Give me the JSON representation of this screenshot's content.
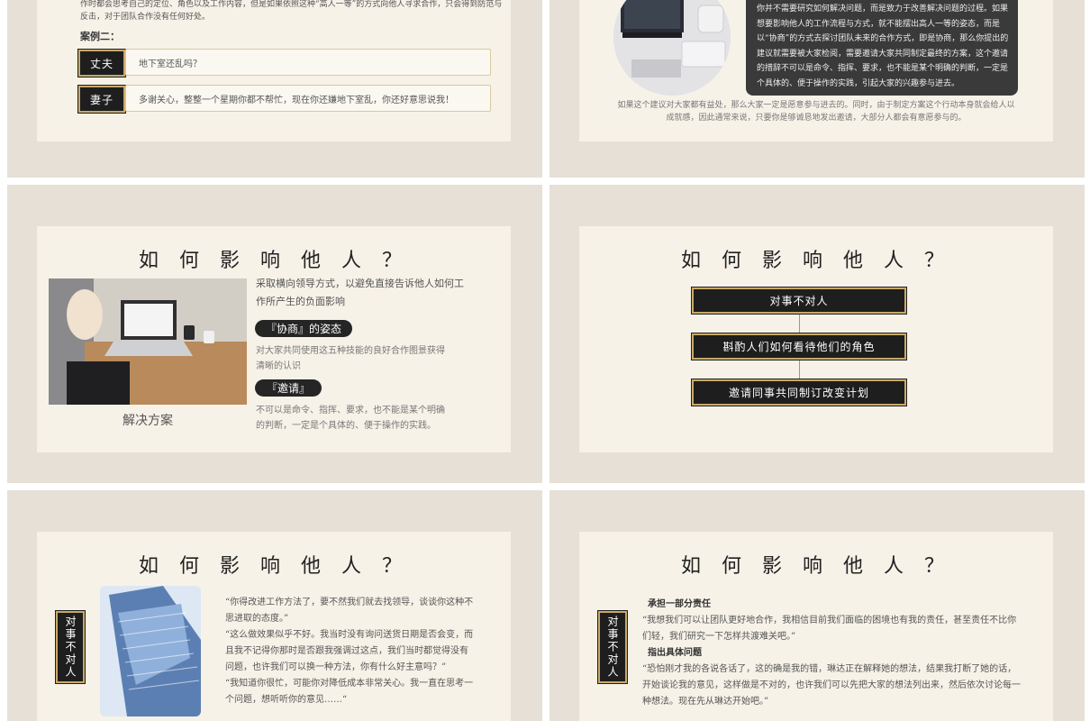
{
  "slide1": {
    "intro": "作时都会思考自己的定位、角色以及工作内容，但是如果依照这种“高人一等”的方式向他人寻求合作，只会得到防范与反击，对于团队合作没有任何好处。",
    "case_label": "案例二：",
    "rows": [
      {
        "role": "丈夫",
        "text": "地下室还乱吗？"
      },
      {
        "role": "妻子",
        "text": "多谢关心，整整一个星期你都不帮忙，现在你还嫌地下室乱，你还好意思说我！"
      }
    ]
  },
  "slide2": {
    "dark_text": "你并不需要研究如何解决问题，而是致力于改善解决问题的过程。如果想要影响他人的工作流程与方式，就不能摆出高人一等的姿态，而是以“协商”的方式去探讨团队未来的合作方式，即是协商，那么你提出的建议就需要被大家检阅，需要邀请大家共同制定最终的方案，这个邀请的措辞不可以是命令、指挥、要求，也不能是某个明确的判断，一定是个具体的、便于操作的实践，引起大家的兴趣参与进去。",
    "bottom_text": "如果这个建议对大家都有益处，那么大家一定是愿意参与进去的。同时，由于制定方案这个行动本身就会给人以成就感，因此通常来说，只要你是够诚恳地发出邀请，大部分人都会有意愿参与的。"
  },
  "slide3": {
    "title": "如 何 影 响 他 人 ？",
    "intro": "采取横向领导方式，以避免直接告诉他人如何工作所产生的负面影响",
    "pill1": "『协商』的姿态",
    "text1": "对大家共同使用这五种技能的良好合作图景获得清晰的认识",
    "pill2": "『邀请』",
    "text2": "不可以是命令、指挥、要求，也不能是某个明确的判断，一定是个具体的、便于操作的实践。",
    "caption": "解决方案"
  },
  "slide4": {
    "title": "如 何 影 响 他 人 ？",
    "steps": [
      "对事不对人",
      "斟酌人们如何看待他们的角色",
      "邀请同事共同制订改变计划"
    ]
  },
  "slide5": {
    "title": "如 何 影 响 他 人 ？",
    "tag": "对事不对人",
    "quotes": [
      "“你得改进工作方法了，要不然我们就去找领导，谈谈你这种不思进取的态度。”",
      "“这么做效果似乎不好。我当时没有询问送货日期是否会变，而且我不记得你那时是否跟我强调过这点，我们当时都觉得没有问题，也许我们可以换一种方法，你有什么好主意吗？”",
      "“我知道你很忙，可能你对降低成本非常关心。我一直在思考一个问题，想听听你的意见……“"
    ]
  },
  "slide6": {
    "title": "如 何 影 响 他 人 ？",
    "tag": "对事不对人",
    "head1": "承担一部分责任",
    "para1": "“我想我们可以让团队更好地合作，我相信目前我们面临的困境也有我的责任，甚至责任不比你们轻，我们研究一下怎样共渡难关吧。”",
    "head2": "指出具体问题",
    "para2": "“恐怕刚才我的各说各话了，这的确是我的错，琳达正在解释她的想法，结果我打断了她的话，开始谈论我的意见，这样做是不对的，也许我们可以先把大家的想法列出来，然后依次讨论每一种想法。现在先从琳达开始吧。”"
  }
}
